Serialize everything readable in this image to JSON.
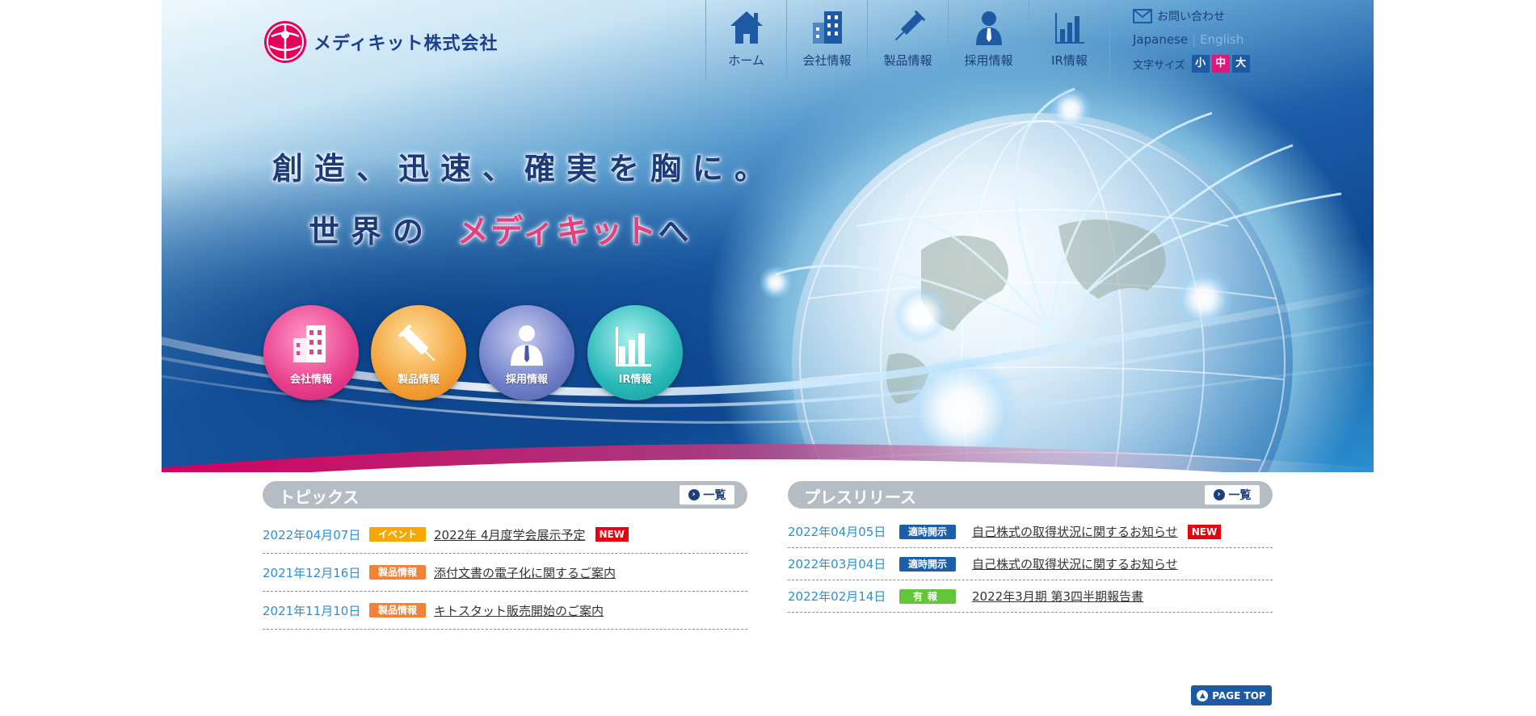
{
  "logo": {
    "text": "メディキット株式会社"
  },
  "gnav": [
    {
      "label": "ホーム",
      "icon": "home-icon"
    },
    {
      "label": "会社情報",
      "icon": "building-icon"
    },
    {
      "label": "製品情報",
      "icon": "syringe-icon"
    },
    {
      "label": "採用情報",
      "icon": "person-icon"
    },
    {
      "label": "IR情報",
      "icon": "bar-chart-icon"
    }
  ],
  "util": {
    "contact": "お問い合わせ",
    "lang_ja": "Japanese",
    "lang_sep": "|",
    "lang_en": "English",
    "fontsize_label": "文字サイズ",
    "fontsize_small": "小",
    "fontsize_medium": "中",
    "fontsize_large": "大"
  },
  "hero": {
    "line1": "創造、迅速、確実を胸に。",
    "line2_a": "世界の",
    "line2_b": "メディキット",
    "line2_c": "へ",
    "circles": [
      {
        "label": "会社情報",
        "icon": "building-icon"
      },
      {
        "label": "製品情報",
        "icon": "syringe-icon"
      },
      {
        "label": "採用情報",
        "icon": "person-icon"
      },
      {
        "label": "IR情報",
        "icon": "bar-chart-icon"
      }
    ]
  },
  "topics": {
    "title": "トピックス",
    "list_label": "一覧",
    "items": [
      {
        "date": "2022年04月07日",
        "badge": "イベント",
        "text": "2022年 4月度学会展示予定",
        "new": "NEW"
      },
      {
        "date": "2021年12月16日",
        "badge": "製品情報",
        "text": "添付文書の電子化に関するご案内"
      },
      {
        "date": "2021年11月10日",
        "badge": "製品情報",
        "text": "キトスタット販売開始のご案内"
      }
    ]
  },
  "press": {
    "title": "プレスリリース",
    "list_label": "一覧",
    "items": [
      {
        "date": "2022年04月05日",
        "badge": "適時開示",
        "text": "自己株式の取得状況に関するお知らせ",
        "new": "NEW"
      },
      {
        "date": "2022年03月04日",
        "badge": "適時開示",
        "text": "自己株式の取得状況に関するお知らせ"
      },
      {
        "date": "2022年02月14日",
        "badge": "有報",
        "text": "2022年3月期 第3四半期報告書"
      }
    ]
  },
  "pagetop": "PAGE TOP",
  "colors": {
    "brand_blue": "#1d5aa3",
    "brand_pink": "#e0177a",
    "date_blue": "#2f8fcc"
  }
}
